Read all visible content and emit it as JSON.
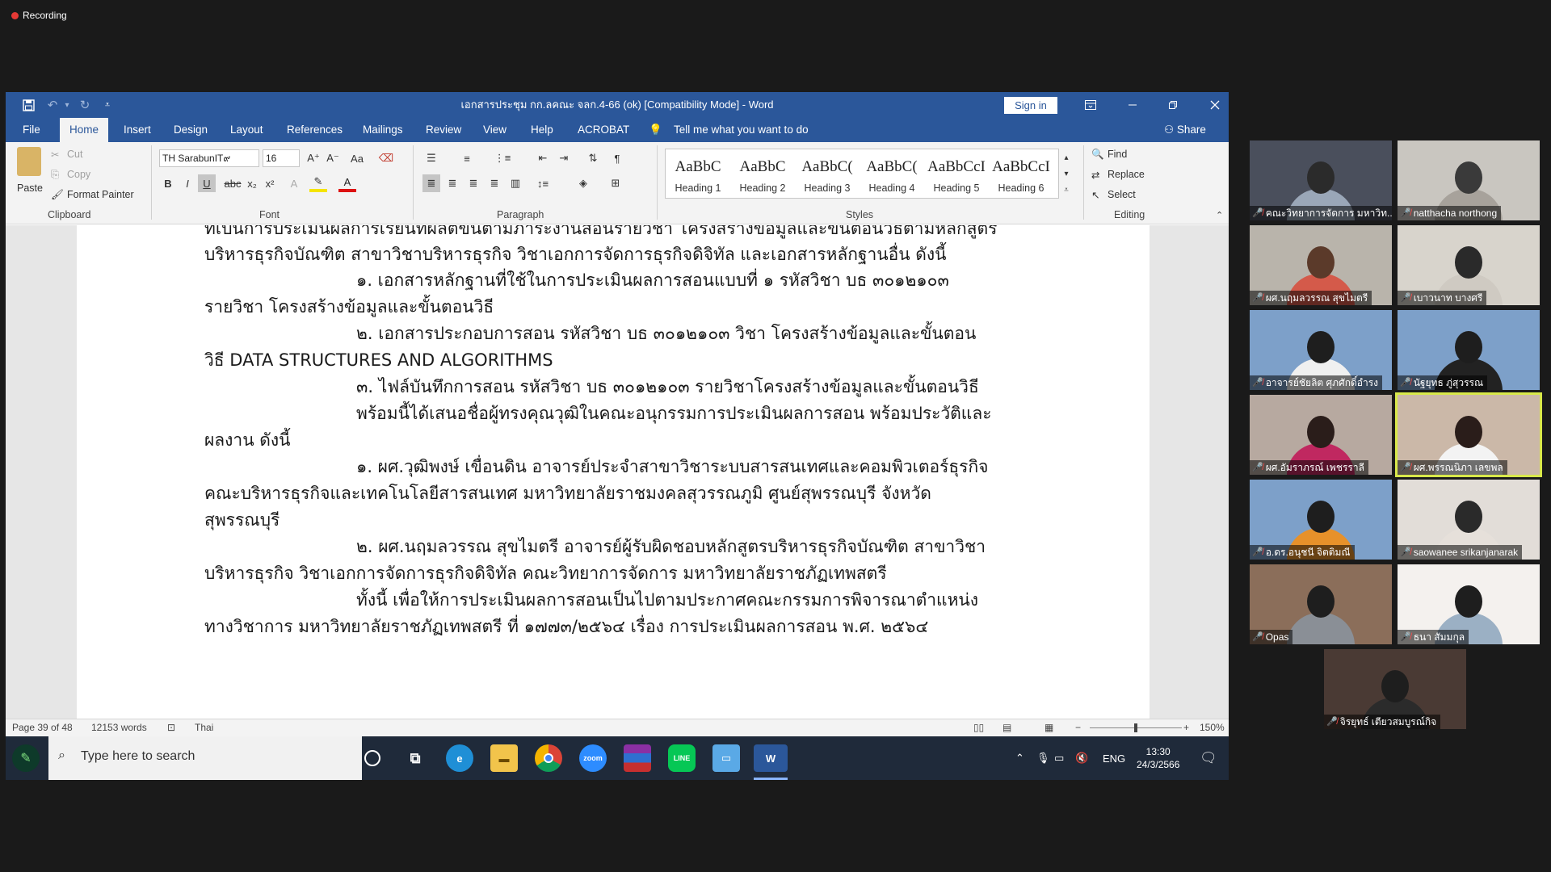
{
  "recording": {
    "label": "Recording"
  },
  "window": {
    "title": "เอกสารประชุม กก.ลคณะ จลก.4-66 (ok) [Compatibility Mode]  -  Word",
    "sign_in": "Sign in"
  },
  "tabs": [
    "File",
    "Home",
    "Insert",
    "Design",
    "Layout",
    "References",
    "Mailings",
    "Review",
    "View",
    "Help",
    "ACROBAT"
  ],
  "tell_me": "Tell me what you want to do",
  "share": "Share",
  "ribbon": {
    "clipboard": {
      "paste": "Paste",
      "cut": "Cut",
      "copy": "Copy",
      "format_painter": "Format Painter",
      "label": "Clipboard"
    },
    "font": {
      "font_name": "TH SarabunIT๙",
      "font_size": "16",
      "label": "Font"
    },
    "paragraph": {
      "label": "Paragraph"
    },
    "styles": {
      "items": [
        {
          "sample": "AaBbC",
          "name": "Heading 1"
        },
        {
          "sample": "AaBbC",
          "name": "Heading 2"
        },
        {
          "sample": "AaBbC(",
          "name": "Heading 3"
        },
        {
          "sample": "AaBbC(",
          "name": "Heading 4"
        },
        {
          "sample": "AaBbCcI",
          "name": "Heading 5"
        },
        {
          "sample": "AaBbCcI",
          "name": "Heading 6"
        }
      ],
      "label": "Styles"
    },
    "editing": {
      "find": "Find",
      "replace": "Replace",
      "select": "Select",
      "label": "Editing"
    }
  },
  "document": {
    "lines": [
      "ที่เป็นการประเมินผลการเรียนที่ผลิตขึ้นตามภาระงานสอนรายวิชา โครงสร้างข้อมูลและขั้นตอนวิธีตามหลักสูตร",
      "บริหารธุรกิจบัณฑิต สาขาวิชาบริหารธุรกิจ วิชาเอกการจัดการธุรกิจดิจิทัล และเอกสารหลักฐานอื่น ดังนี้",
      "๑. เอกสารหลักฐานที่ใช้ในการประเมินผลการสอนแบบที่ ๑ รหัสวิชา บธ ๓๐๑๒๑๐๓",
      "รายวิชา โครงสร้างข้อมูลและขั้นตอนวิธี",
      "๒. เอกสารประกอบการสอน รหัสวิชา บธ ๓๐๑๒๑๐๓ วิชา โครงสร้างข้อมูลและขั้นตอน",
      "วิธี DATA STRUCTURES AND ALGORITHMS",
      "๓. ไฟล์บันทึกการสอน รหัสวิชา บธ ๓๐๑๒๑๐๓ รายวิชาโครงสร้างข้อมูลและขั้นตอนวิธี",
      "พร้อมนี้ได้เสนอชื่อผู้ทรงคุณวุฒิในคณะอนุกรรมการประเมินผลการสอน พร้อมประวัติและ",
      "ผลงาน ดังนี้",
      "๑. ผศ.วุฒิพงษ์ เขื่อนดิน อาจารย์ประจำสาขาวิชาระบบสารสนเทศและคอมพิวเตอร์ธุรกิจ",
      "คณะบริหารธุรกิจและเทคโนโลยีสารสนเทศ มหาวิทยาลัยราชมงคลสุวรรณภูมิ ศูนย์สุพรรณบุรี จังหวัด",
      "สุพรรณบุรี",
      "๒. ผศ.นฤมลวรรณ สุขไมตรี อาจารย์ผู้รับผิดชอบหลักสูตรบริหารธุรกิจบัณฑิต สาขาวิชา",
      "บริหารธุรกิจ วิชาเอกการจัดการธุรกิจดิจิทัล คณะวิทยาการจัดการ มหาวิทยาลัยราชภัฏเทพสตรี",
      "ทั้งนี้ เพื่อให้การประเมินผลการสอนเป็นไปตามประกาศคณะกรรมการพิจารณาตำแหน่ง",
      "ทางวิชาการ มหาวิทยาลัยราชภัฏเทพสตรี ที่ ๑๗๗๓/๒๕๖๔  เรื่อง การประเมินผลการสอน พ.ศ. ๒๕๖๔"
    ]
  },
  "status": {
    "page": "Page 39 of 48",
    "words": "12153 words",
    "language": "Thai",
    "zoom": "150%",
    "zoom_level": 0.5
  },
  "taskbar": {
    "search_placeholder": "Type here to search",
    "lang": "ENG",
    "time": "13:30",
    "date": "24/3/2566",
    "apps": [
      "task-view",
      "edge",
      "file-explorer",
      "chrome",
      "zoom",
      "winrar",
      "line",
      "pictures",
      "word"
    ]
  },
  "participants": [
    {
      "name": "คณะวิทยาการจัดการ มหาวิท..."
    },
    {
      "name": "natthacha northong"
    },
    {
      "name": "ผศ.นฤมลวรรณ สุขไมตรี"
    },
    {
      "name": "เบาวนาท บางศรี"
    },
    {
      "name": "อาจารย์ชัยลิต ศุภศักดิ์อำรง"
    },
    {
      "name": "นัฐยุทธ ภู่สุวรรณ"
    },
    {
      "name": "ผศ.อัมราภรณ์ เพชรราลี"
    },
    {
      "name": "ผศ.พรรณนิภา เลขพล"
    },
    {
      "name": "อ.ดร.อนุชนี จิตติมณี"
    },
    {
      "name": "saowanee srikanjanarak"
    },
    {
      "name": "Opas"
    },
    {
      "name": "ธนา สัมมกุล"
    },
    {
      "name": "จิรยุทธ์ เตียวสมบูรณ์กิจ"
    }
  ],
  "colors": {
    "word_blue": "#2b579a",
    "speaker_highlight": "#d8e84a",
    "taskbar": "#1f2a3a"
  }
}
